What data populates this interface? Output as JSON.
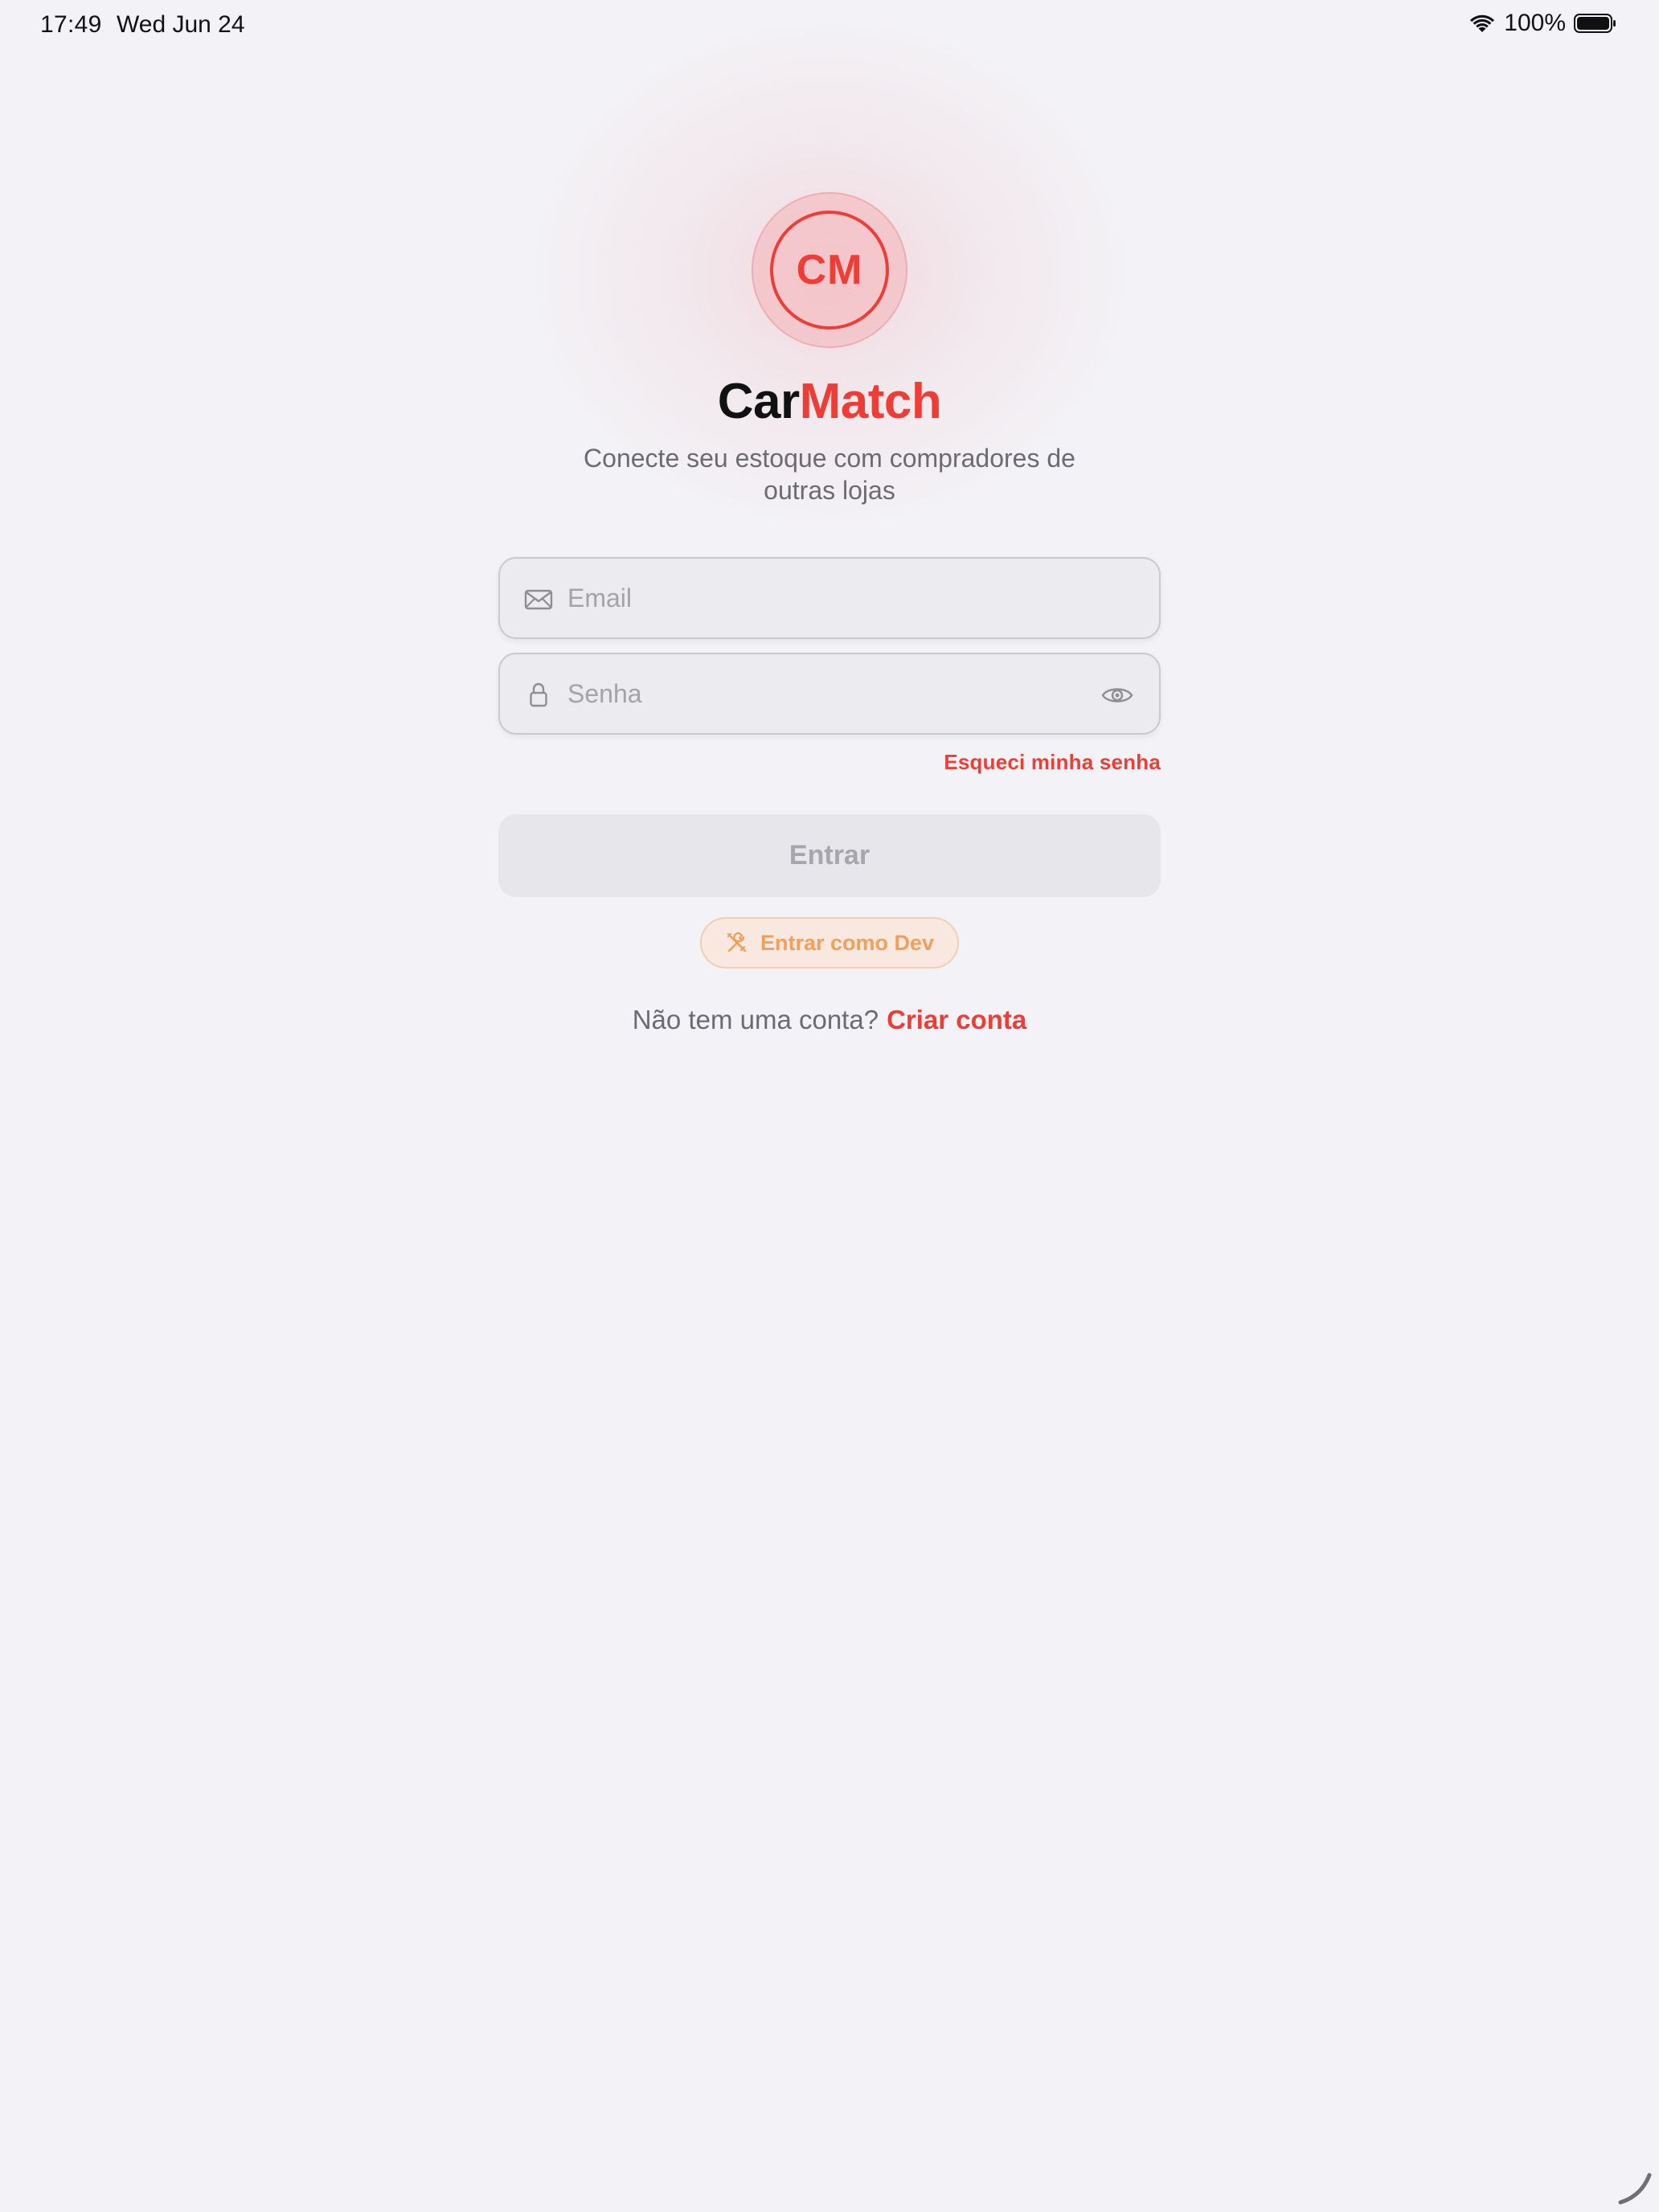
{
  "status_bar": {
    "time": "17:49",
    "date": "Wed Jun 24",
    "battery": "100%",
    "icons": [
      "wifi-icon",
      "battery-icon"
    ]
  },
  "logo": {
    "initials": "CM",
    "accent_color": "#ef3d36"
  },
  "title": {
    "part1": "Car",
    "part2": "Match"
  },
  "subtitle": "Conecte seu estoque com compradores de outras lojas",
  "form": {
    "email_placeholder": "Email",
    "email_value": "",
    "password_placeholder": "Senha",
    "password_value": "",
    "forgot_password": "Esqueci minha senha",
    "login_button": "Entrar",
    "dev_button": "Entrar como Dev"
  },
  "signup": {
    "question": "Não tem uma conta?",
    "link": "Criar conta"
  },
  "colors": {
    "background": "#f3f3f7",
    "accent": "#ef3d36",
    "dev_accent": "#f0a05a",
    "disabled_button": "#e6e6eb"
  }
}
